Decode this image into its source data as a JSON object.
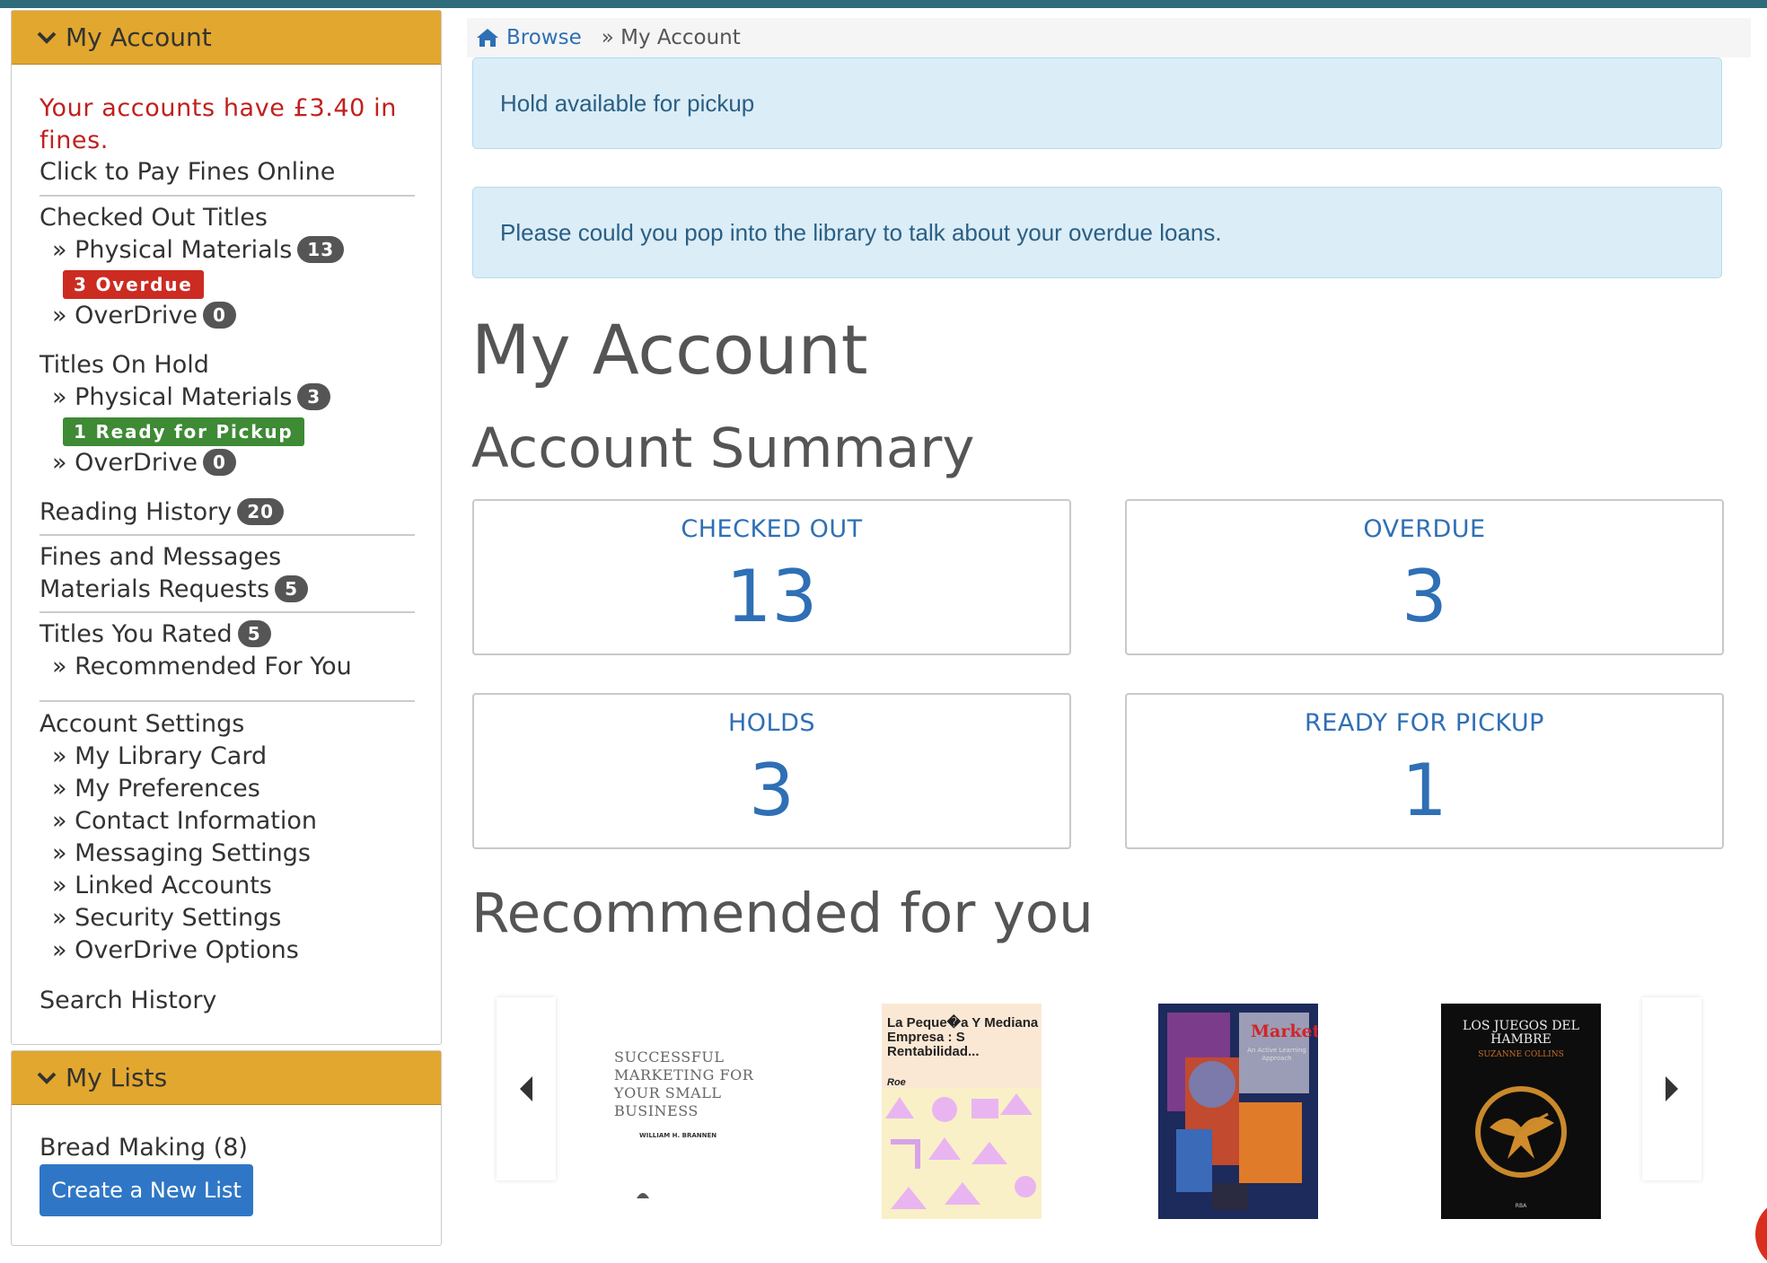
{
  "sidebar": {
    "account_title": "My Account",
    "fines_warning": "Your accounts have £3.40 in fines.",
    "pay_fines": "Click to Pay Fines Online",
    "checked_out": {
      "heading": "Checked Out Titles",
      "physical_label": "» Physical Materials",
      "physical_count": "13",
      "overdue_label": "3 Overdue",
      "overdrive_label": "» OverDrive",
      "overdrive_count": "0"
    },
    "holds": {
      "heading": "Titles On Hold",
      "physical_label": "» Physical Materials",
      "physical_count": "3",
      "ready_label": "1 Ready for Pickup",
      "overdrive_label": "» OverDrive",
      "overdrive_count": "0"
    },
    "reading_history": {
      "label": "Reading History",
      "count": "20"
    },
    "fines_messages": "Fines and Messages",
    "materials_requests": {
      "label": "Materials Requests",
      "count": "5"
    },
    "titles_rated": {
      "label": "Titles You Rated",
      "count": "5"
    },
    "recommended": "» Recommended For You",
    "account_settings": {
      "heading": "Account Settings",
      "items": [
        "» My Library Card",
        "» My Preferences",
        "» Contact Information",
        "» Messaging Settings",
        "» Linked Accounts",
        "» Security Settings",
        "» OverDrive Options"
      ]
    },
    "search_history": "Search History",
    "lists_title": "My Lists",
    "list_item": "Bread Making (8)",
    "create_list": "Create a New List"
  },
  "breadcrumb": {
    "home": "Browse",
    "current": "» My Account"
  },
  "alerts": [
    "Hold available for pickup",
    "Please could you pop into the library to talk about your overdue loans."
  ],
  "page_title": "My Account",
  "summary_title": "Account Summary",
  "stats": [
    {
      "label": "CHECKED OUT",
      "value": "13"
    },
    {
      "label": "OVERDUE",
      "value": "3"
    },
    {
      "label": "HOLDS",
      "value": "3"
    },
    {
      "label": "READY FOR PICKUP",
      "value": "1"
    }
  ],
  "recommended_title": "Recommended for you",
  "covers": [
    {
      "title": "SUCCESSFUL MARKETING FOR YOUR SMALL BUSINESS",
      "author": "WILLIAM H. BRANNEN"
    },
    {
      "title": "La Peque�a Y Mediana Empresa : S Rentabilidad...",
      "author": "Roe"
    },
    {
      "title": "Marketing",
      "subtitle": "An Active Learning Approach"
    },
    {
      "title": "LOS JUEGOS DEL HAMBRE",
      "author": "SUZANNE COLLINS",
      "publisher": "RBA"
    }
  ],
  "colors": {
    "top_bar": "#2e6b7b",
    "panel_header": "#e2a72e",
    "link": "#2f6fb5",
    "fines_red": "#c0201f",
    "overdue_red": "#cc2b22",
    "ready_green": "#3e8a35",
    "alert_bg": "#dbedf7",
    "button_blue": "#2f77c6"
  }
}
